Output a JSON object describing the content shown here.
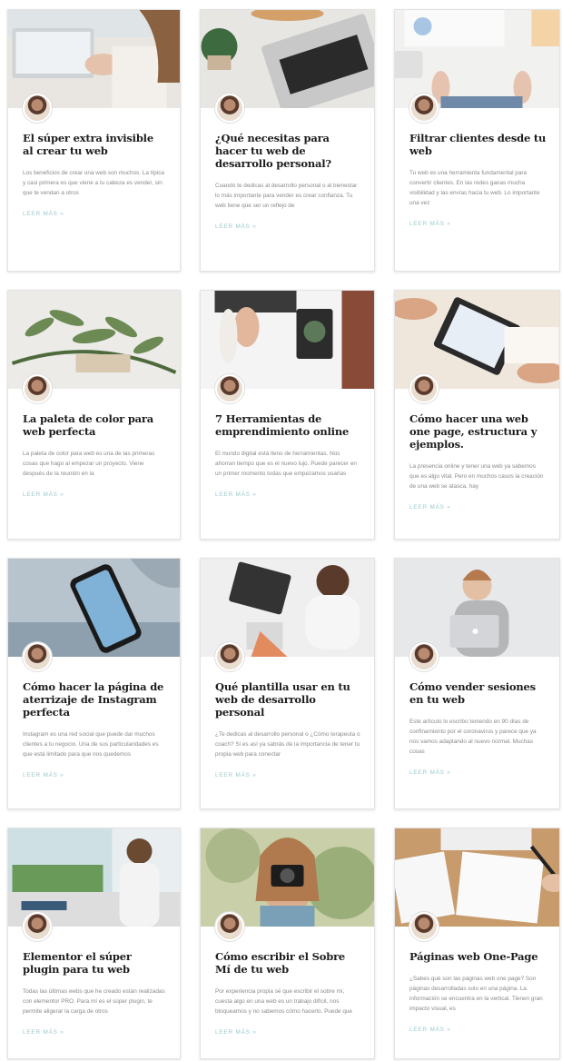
{
  "posts": [
    {
      "title": "El súper extra invisible al crear tu web",
      "excerpt": "Los beneficios de crear una web son muchos. La típica y casi primera es que viene a tu cabeza es vender, sin que te vendan a otros",
      "more": "LEER MÁS »",
      "thumb": "laptop-hands"
    },
    {
      "title": "¿Qué necesitas para hacer tu web de desarrollo personal?",
      "excerpt": "Cuando te dedicas al desarrollo personal o al bienestar lo más importante para vender es crear confianza. Tu web tiene que ser un reflejo de",
      "more": "LEER MÁS »",
      "thumb": "laptop-plant"
    },
    {
      "title": "Filtrar clientes desde tu web",
      "excerpt": "Tu web es una herramienta fundamental para convertir clientes. En las redes ganas mucha visibilidad y las envías hacia tu web. Lo importante una vez",
      "more": "LEER MÁS »",
      "thumb": "desk-top"
    },
    {
      "title": "La paleta de color para web perfecta",
      "excerpt": "La paleta de color para web es una de las primeras cosas que hago al empezar un proyecto. Viene después de la reunión en la",
      "more": "LEER MÁS »",
      "thumb": "leaves"
    },
    {
      "title": "7 Herramientas de emprendimiento online",
      "excerpt": "El mundo digital está lleno de herramientas. Nos ahorran tiempo que es el nuevo lujo. Puede parecer en un primer momento todas que empezamos usarlas",
      "more": "LEER MÁS »",
      "thumb": "keyboard-plant"
    },
    {
      "title": "Cómo hacer una web one page, estructura y ejemplos.",
      "excerpt": "La presencia online y tener una web ya sabemos que es algo vital. Pero en muchos casos la creación de una web se atasca, hay",
      "more": "LEER MÁS »",
      "thumb": "tablet-hands"
    },
    {
      "title": "Cómo hacer la página de aterrizaje de Instagram perfecta",
      "excerpt": "Instagram es una red social que puede dar muchos clientes a tu negocio. Una de sus particularidades es que está limitado para que nos quedemos",
      "more": "LEER MÁS »",
      "thumb": "phone"
    },
    {
      "title": "Qué plantilla usar en tu web de desarrollo personal",
      "excerpt": "¿Te dedicas al desarrollo personal o ¿Cómo terapeuta o coach? Si es así ya sabrás de la importancia de tener tu propia web para conectar",
      "more": "LEER MÁS »",
      "thumb": "woman-laptop"
    },
    {
      "title": "Cómo vender sesiones en tu web",
      "excerpt": "Este artículo lo escribo teniendo en 90 días de confinamiento por el coronavirus y parece que ya nos vamos adaptando al nuevo normal. Muchas cosas",
      "more": "LEER MÁS »",
      "thumb": "woman-smiling"
    },
    {
      "title": "Elementor el súper plugin para tu web",
      "excerpt": "Todas las últimas webs que he creado están realizadas con elementor PRO. Para mí es el súper plugin, te permite aligerar la carga de otros",
      "more": "LEER MÁS »",
      "thumb": "woman-window"
    },
    {
      "title": "Cómo escribir el Sobre Mí de tu web",
      "excerpt": "Por experiencia propia sé que escribir el sobre mí, cuesta algo en una web es un trabajo difícil, nos bloqueamos y no sabemos cómo hacerlo. Puede que",
      "more": "LEER MÁS »",
      "thumb": "camera-woman"
    },
    {
      "title": "Páginas web One-Page",
      "excerpt": "¿Sabes qué son las páginas web one page? Son páginas desarrolladas solo en una página. La información se encuentra en la vertical. Tienen gran impacto visual, es",
      "more": "LEER MÁS »",
      "thumb": "sketch-desk"
    }
  ]
}
